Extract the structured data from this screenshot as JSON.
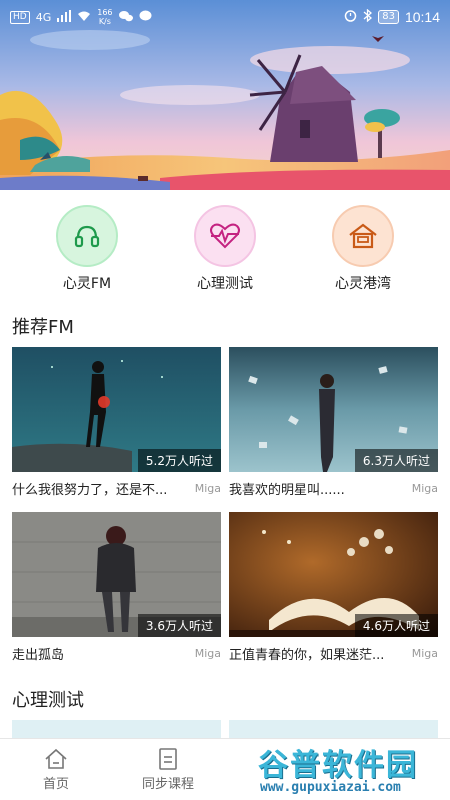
{
  "status_bar": {
    "hd": "HD",
    "signal": "4G",
    "speed_top": "166",
    "speed_bottom": "K/s",
    "battery": "83",
    "time": "10:14"
  },
  "categories": [
    {
      "label": "心灵FM",
      "icon": "headphones-icon",
      "color": "#2dbb5f"
    },
    {
      "label": "心理测试",
      "icon": "heart-pulse-icon",
      "color": "#d0288a"
    },
    {
      "label": "心灵港湾",
      "icon": "harbor-house-icon",
      "color": "#e06a1e"
    }
  ],
  "recommend_fm": {
    "title": "推荐FM",
    "cards": [
      {
        "listeners": "5.2万人听过",
        "title": "什么我很努力了，还是不...",
        "author": "Miga"
      },
      {
        "listeners": "6.3万人听过",
        "title": "我喜欢的明星叫......",
        "author": "Miga"
      },
      {
        "listeners": "3.6万人听过",
        "title": "走出孤岛",
        "author": "Miga"
      },
      {
        "listeners": "4.6万人听过",
        "title": "正值青春的你，如果迷茫...",
        "author": "Miga"
      }
    ]
  },
  "psych_test": {
    "title": "心理测试"
  },
  "bottom_nav": [
    {
      "label": "首页",
      "icon": "home-icon"
    },
    {
      "label": "同步课程",
      "icon": "document-icon"
    }
  ],
  "watermark": {
    "main": "谷普软件园",
    "sub": "www.gupuxiazai.com"
  }
}
